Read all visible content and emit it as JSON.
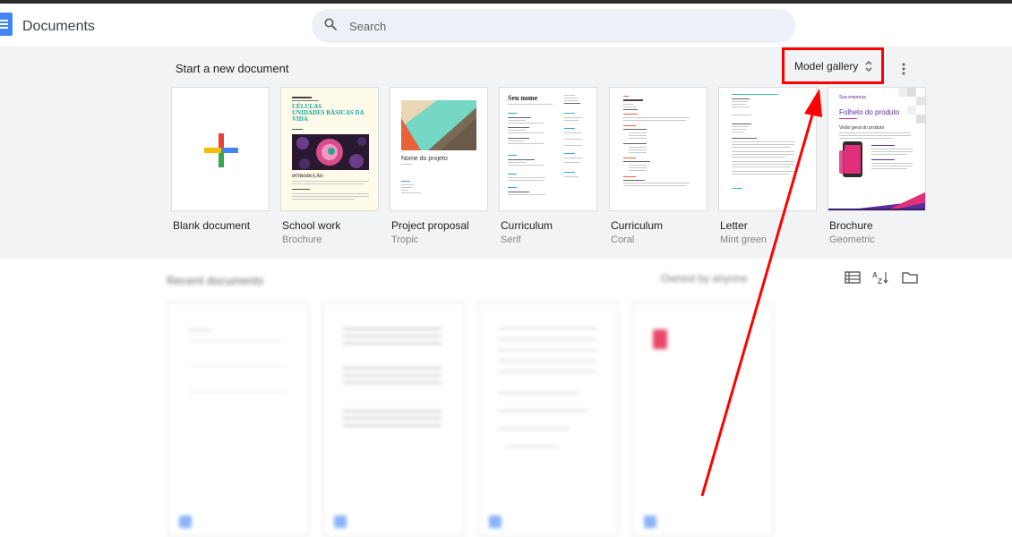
{
  "header": {
    "app_title": "Documents",
    "search_placeholder": "Search"
  },
  "gallery": {
    "title": "Start a new document",
    "model_gallery_label": "Model gallery",
    "templates": [
      {
        "name": "Blank document",
        "subtitle": ""
      },
      {
        "name": "School work",
        "subtitle": "Brochure"
      },
      {
        "name": "Project proposal",
        "subtitle": "Tropic"
      },
      {
        "name": "Curriculum",
        "subtitle": "Serif"
      },
      {
        "name": "Curriculum",
        "subtitle": "Coral"
      },
      {
        "name": "Letter",
        "subtitle": "Mint green"
      },
      {
        "name": "Brochure",
        "subtitle": "Geometric"
      }
    ],
    "thumb_text": {
      "school_title": "CÉLULAS\nUNIDADES BÁSICAS DA VIDA",
      "school_intro": "INTRODUÇÃO",
      "proposal_title": "Nome do projeto",
      "curriculum_name": "Seu nome",
      "brochure_company": "Sua empresa",
      "brochure_title": "Folheto do produto",
      "brochure_sub": "Visão geral do produto"
    }
  },
  "recent": {
    "title": "Recent documents",
    "owner_filter": "Owned by anyone"
  },
  "colors": {
    "annotation": "#ff0000",
    "gallery_bg": "#f1f3f4",
    "brand_blue": "#4285f4"
  },
  "icons": [
    "docs-logo-icon",
    "search-icon",
    "unfold-icon",
    "more-vert-icon",
    "plus-icon",
    "list-view-icon",
    "sort-az-icon",
    "folder-icon"
  ]
}
